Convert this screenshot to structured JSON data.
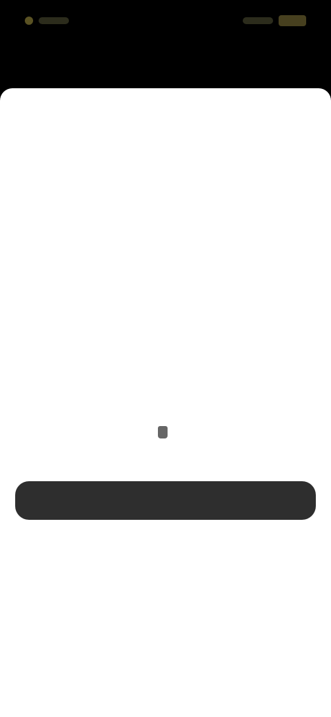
{
  "status_bar": {
    "left_indicator": "",
    "left_label": "",
    "right_label": ""
  },
  "sheet": {
    "title": "",
    "subtitle": "",
    "detail": "",
    "footer_note": "",
    "primary_button_label": "",
    "secondary_link_label": ""
  },
  "colors": {
    "sheet_background": "#ffffff",
    "primary_button": "#2e2e2e",
    "screen_background": "#000000"
  },
  "icons": {
    "status_dot": "dot-indicator",
    "battery": "battery-icon",
    "lock": "lock-icon"
  }
}
